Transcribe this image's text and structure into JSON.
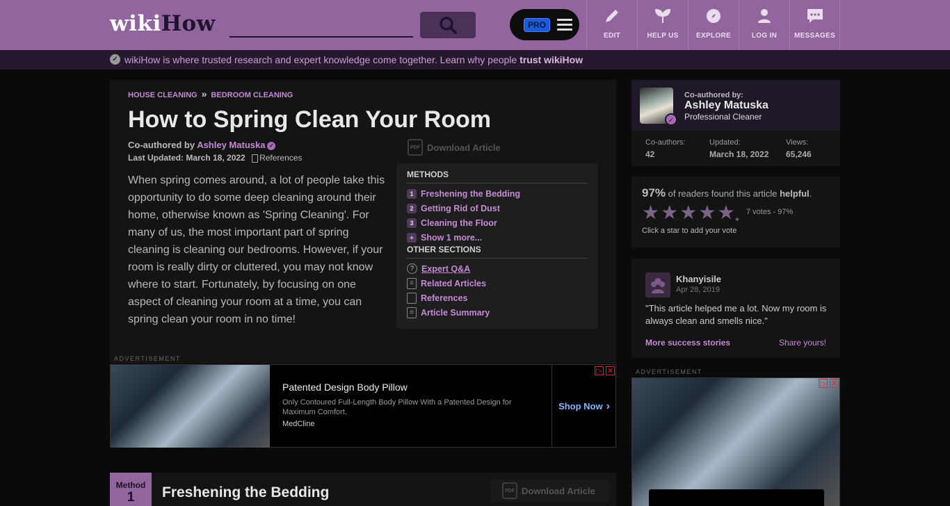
{
  "header": {
    "logo_wiki": "wiki",
    "logo_how": "How",
    "search_placeholder": "",
    "pro_badge": "PRO",
    "nav": [
      {
        "label": "EDIT",
        "icon": "pencil-icon"
      },
      {
        "label": "HELP US",
        "icon": "sprout-icon"
      },
      {
        "label": "EXPLORE",
        "icon": "compass-icon"
      },
      {
        "label": "LOG IN",
        "icon": "user-icon"
      },
      {
        "label": "MESSAGES",
        "icon": "chat-icon"
      }
    ]
  },
  "trust_bar": {
    "text": "wikiHow is where trusted research and expert knowledge come together. Learn why people ",
    "link": "trust wikiHow"
  },
  "article": {
    "breadcrumbs": [
      "HOUSE CLEANING",
      "BEDROOM CLEANING"
    ],
    "breadcrumb_sep": "»",
    "title": "How to Spring Clean Your Room",
    "coauthored_label": "Co-authored by ",
    "author": "Ashley Matuska",
    "last_updated": "Last Updated: March 18, 2022",
    "references_label": "References",
    "download_label": "Download Article",
    "pdf_label": "PDF",
    "intro": "When spring comes around, a lot of people take this opportunity to do some deep cleaning around their home, otherwise known as 'Spring Cleaning'. For many of us, the most important part of spring cleaning is cleaning our bedrooms. However, if your room is really dirty or cluttered, you may not know where to start. Fortunately, by focusing on one aspect of cleaning your room at a time, you can spring clean your room in no time!"
  },
  "toc": {
    "methods_heading": "METHODS",
    "methods": [
      {
        "num": "1",
        "label": "Freshening the Bedding"
      },
      {
        "num": "2",
        "label": "Getting Rid of Dust"
      },
      {
        "num": "3",
        "label": "Cleaning the Floor"
      },
      {
        "num": "+",
        "label": "Show 1 more..."
      }
    ],
    "other_heading": "OTHER SECTIONS",
    "other": [
      {
        "label": "Expert Q&A",
        "icon": "question-icon"
      },
      {
        "label": "Related Articles",
        "icon": "document-icon"
      },
      {
        "label": "References",
        "icon": "bookmark-icon"
      },
      {
        "label": "Article Summary",
        "icon": "summary-icon"
      }
    ]
  },
  "ad1": {
    "label": "ADVERTISEMENT",
    "title": "Patented Design Body Pillow",
    "description": "Only Contoured Full-Length Body Pillow With a Patented Design for Maximum Comfort.",
    "brand": "MedCline",
    "cta": "Shop Now"
  },
  "method1": {
    "label": "Method",
    "number": "1",
    "title": "Freshening the Bedding",
    "download_label": "Download Article"
  },
  "sidebar": {
    "coauthored_by": "Co-authored by:",
    "author_name": "Ashley Matuska",
    "author_role": "Professional Cleaner",
    "stats": [
      {
        "label": "Co-authors:",
        "value": "42"
      },
      {
        "label": "Updated:",
        "value": "March 18, 2022"
      },
      {
        "label": "Views:",
        "value": "65,246"
      }
    ],
    "rating": {
      "percent": "97%",
      "text_mid": " of readers found this article ",
      "text_bold": "helpful",
      "text_end": ".",
      "stars": 5,
      "votes": "7 votes - 97%",
      "hint": "Click a star to add your vote"
    },
    "review": {
      "name": "Khanyisile",
      "date": "Apr 28, 2019",
      "text": "\"This article helped me a lot. Now my room is always clean and smells nice.\"",
      "more": "More success stories",
      "share": "Share yours!"
    },
    "ad_label": "ADVERTISEMENT"
  }
}
